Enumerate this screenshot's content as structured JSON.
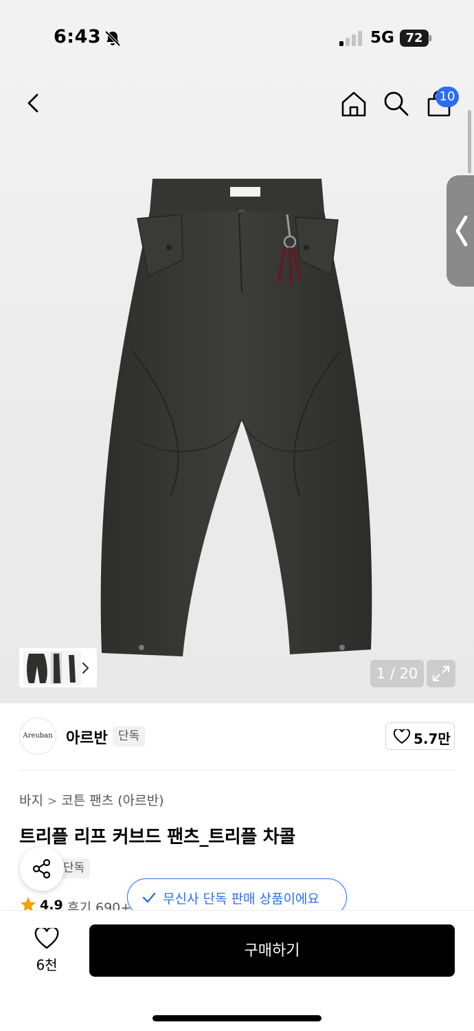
{
  "status_bar": {
    "time": "6:43",
    "network": "5G",
    "battery": "72"
  },
  "header": {
    "cart_count": "10"
  },
  "gallery": {
    "counter": "1 / 20"
  },
  "brand": {
    "logo_text": "Areuban",
    "name": "아르반",
    "tag": "단독",
    "likes": "5.7만"
  },
  "breadcrumb": {
    "category": "바지",
    "subcategory": "코튼 팬츠 (아르반)"
  },
  "product": {
    "title": "트리플 리프 커브드 팬츠_트리플 차콜",
    "tag": "단독",
    "rating": "4.9",
    "reviews": "후기 690+"
  },
  "notice": {
    "exclusive": "무신사 단독 판매 상품이에요"
  },
  "bottom_bar": {
    "wish_count": "6천",
    "buy_label": "구매하기"
  },
  "colors": {
    "accent": "#2b6ef5",
    "buy_button": "#000000",
    "star": "#f5a000"
  },
  "icons": [
    "bell-off-icon",
    "signal-icon",
    "back-icon",
    "home-icon",
    "search-icon",
    "cart-icon",
    "chevron-left-icon",
    "fullscreen-icon",
    "heart-icon",
    "share-icon",
    "star-icon",
    "check-icon"
  ]
}
